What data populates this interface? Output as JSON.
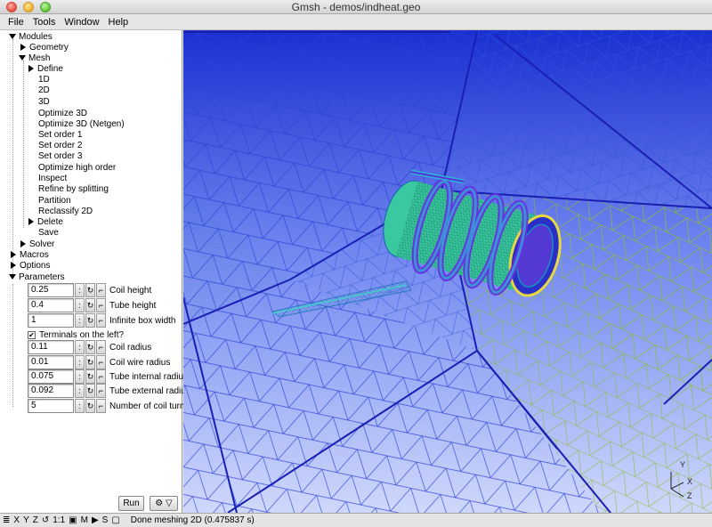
{
  "window": {
    "title": "Gmsh - demos/indheat.geo"
  },
  "menu": [
    {
      "label": "File"
    },
    {
      "label": "Tools"
    },
    {
      "label": "Window"
    },
    {
      "label": "Help"
    }
  ],
  "tree": {
    "modules": "Modules",
    "geometry": "Geometry",
    "mesh": "Mesh",
    "mesh_items": [
      "Define",
      "1D",
      "2D",
      "3D",
      "Optimize 3D",
      "Optimize 3D (Netgen)",
      "Set order 1",
      "Set order 2",
      "Set order 3",
      "Optimize high order",
      "Inspect",
      "Refine by splitting",
      "Partition",
      "Reclassify 2D",
      "Delete",
      "Save"
    ],
    "solver": "Solver",
    "macros": "Macros",
    "options": "Options",
    "parameters": "Parameters"
  },
  "parameters": [
    {
      "value": "0.25",
      "label": "Coil height"
    },
    {
      "value": "0.4",
      "label": "Tube height"
    },
    {
      "value": "1",
      "label": "Infinite box width"
    },
    {
      "value": "0.11",
      "label": "Coil radius"
    },
    {
      "value": "0.01",
      "label": "Coil wire radius"
    },
    {
      "value": "0.075",
      "label": "Tube internal radius"
    },
    {
      "value": "0.092",
      "label": "Tube external radius"
    },
    {
      "value": "5",
      "label": "Number of coil turns"
    }
  ],
  "terminals": {
    "label": "Terminals on the left?",
    "checked": true,
    "mark": "✔"
  },
  "buttons": {
    "run": "Run",
    "gear": "⚙ ▽"
  },
  "statusbar": {
    "menu_glyph": "≣",
    "x": "X",
    "y": "Y",
    "z": "Z",
    "one_to_one": "1:1",
    "m": "M",
    "s": "S",
    "message": "Done meshing 2D (0.475837 s)"
  },
  "axes": {
    "x": "X",
    "y": "Y",
    "z": "Z"
  },
  "colors": {
    "accent": "#1a2fd0",
    "mesh_line": "#2a40d8",
    "mesh_green": "#32c8a0"
  }
}
